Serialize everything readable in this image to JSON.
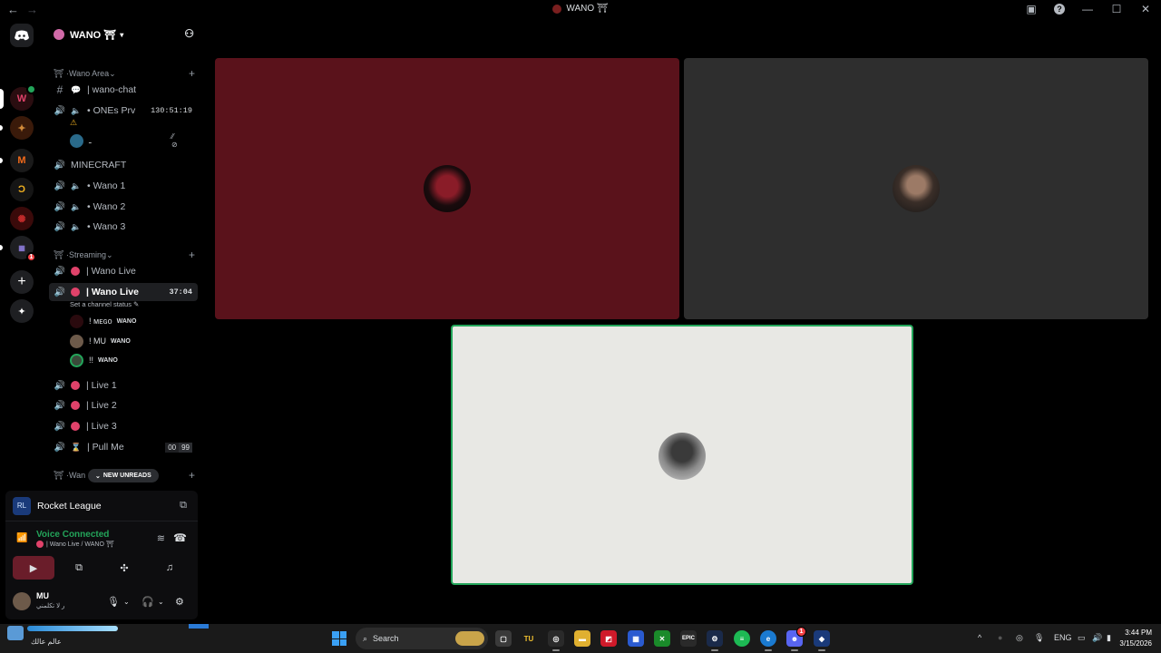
{
  "window": {
    "title": "WANO ⛩",
    "nav_back": "←",
    "nav_forward": "→",
    "inbox_icon": "inbox-icon",
    "help_icon": "?",
    "minimize": "—",
    "maximize": "☐",
    "close": "✕"
  },
  "server": {
    "name": "WANO ⛩",
    "invite_icon": "add-member-icon"
  },
  "rail": {
    "home_icon": "discord-icon",
    "mention_badge": "1",
    "add_server": "+",
    "discover": "✦"
  },
  "categories": [
    {
      "name": "Wano Area"
    },
    {
      "name": "Streaming"
    },
    {
      "name": "Wan"
    }
  ],
  "channels_area": [
    {
      "icon": "#",
      "emoji": "💬",
      "name": "| wano-chat"
    },
    {
      "icon": "🔊",
      "name": "• ONEs Prv",
      "timer": "130:51:19",
      "emoji": "⚠"
    },
    {
      "icon": "🔊",
      "name": "MINECRAFT"
    },
    {
      "icon": "🔊",
      "name": "• Wano 1"
    },
    {
      "icon": "🔊",
      "name": "• Wano 2"
    },
    {
      "icon": "🔊",
      "name": "• Wano 3"
    }
  ],
  "prv_member": {
    "name": "ـ",
    "icons": "⁄⁄ ⊘"
  },
  "channels_streaming": [
    {
      "name": "| Wano Live"
    },
    {
      "name": "| Wano Live",
      "timer": "37:04",
      "status": "Set a channel status ✎"
    },
    {
      "name": "| Live 1"
    },
    {
      "name": "| Live 2"
    },
    {
      "name": "| Live 3"
    },
    {
      "name": "| Pull Me",
      "count_a": "00",
      "count_b": "99"
    }
  ],
  "stream_members": [
    {
      "name": "! ᴍᴇɢᴏ",
      "tag": "WANO"
    },
    {
      "name": "! MU",
      "tag": "WANO"
    },
    {
      "name": "!!",
      "tag": "WANO"
    }
  ],
  "new_unreads": "NEW UNREADS",
  "activity": {
    "name": "Rocket League"
  },
  "voice": {
    "title": "Voice Connected",
    "channel": "| Wano Live / WANO ⛩"
  },
  "user": {
    "name": "MU",
    "status": "ر لا تكلمني"
  },
  "taskbar": {
    "search": "Search",
    "weather_text": "عالم عالك",
    "lang": "ENG",
    "time": "3:44 PM",
    "date": "3/15/2026",
    "discord_badge": "1",
    "apps": [
      "TU",
      "EPIC"
    ]
  },
  "colors": {
    "accent_green": "#23a55a",
    "live_red": "#e0426a",
    "tile_red": "#5a121b"
  }
}
